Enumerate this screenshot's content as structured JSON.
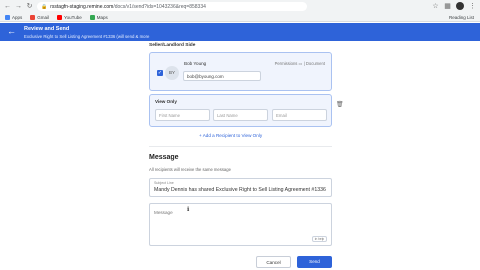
{
  "browser": {
    "url_host": "rsstagfn-staging.remine.com",
    "url_path": "/docs/v1/send?ids=1043236&req=858334",
    "bookmarks": [
      {
        "label": "Apps",
        "color": "#4285f4"
      },
      {
        "label": "Gmail",
        "color": "#ea4335"
      },
      {
        "label": "YouTube",
        "color": "#ff0000"
      },
      {
        "label": "Maps",
        "color": "#34a853"
      }
    ],
    "reading_list": "Reading List"
  },
  "header": {
    "title": "Review and Send",
    "subtitle": "Exclusive Right to Sell Listing Agreement #1336 (will send & more"
  },
  "signer_section": {
    "label": "Seller/Landlord Side",
    "signer": {
      "initials": "BY",
      "name": "Bob Young",
      "permissions_label": "Permissions ▭ | Document",
      "email": "bob@byoung.com"
    }
  },
  "view_only": {
    "label": "View Only",
    "first_name_placeholder": "First Name",
    "last_name_placeholder": "Last Name",
    "email_placeholder": "Email"
  },
  "add_recipient_label": "+ Add a Recipient to View Only",
  "message": {
    "heading": "Message",
    "note": "All recipients will receive the same message",
    "subject_label": "Subject Line",
    "subject_value": "Mandy Dennis has shared Exclusive Right to Sell Listing Agreement #1336",
    "body_placeholder": "Message",
    "help_label": "in help"
  },
  "actions": {
    "cancel": "Cancel",
    "send": "Send"
  },
  "colors": {
    "accent": "#2e63d9",
    "card_bg": "#f0f4fd",
    "card_border": "#aac2f1"
  }
}
